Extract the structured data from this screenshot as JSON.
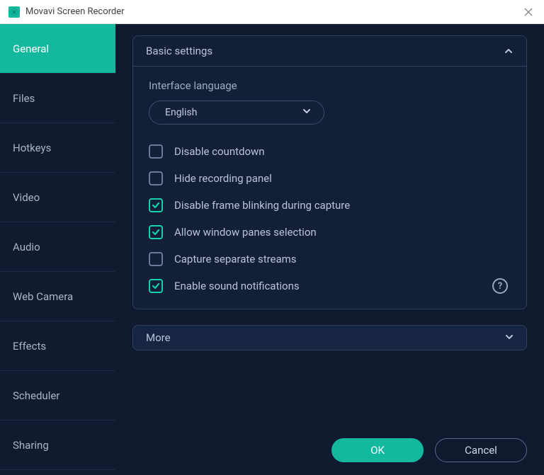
{
  "window": {
    "title": "Movavi Screen Recorder"
  },
  "sidebar": {
    "items": [
      {
        "label": "General",
        "active": true
      },
      {
        "label": "Files",
        "active": false
      },
      {
        "label": "Hotkeys",
        "active": false
      },
      {
        "label": "Video",
        "active": false
      },
      {
        "label": "Audio",
        "active": false
      },
      {
        "label": "Web Camera",
        "active": false
      },
      {
        "label": "Effects",
        "active": false
      },
      {
        "label": "Scheduler",
        "active": false
      },
      {
        "label": "Sharing",
        "active": false
      }
    ]
  },
  "panel": {
    "title": "Basic settings",
    "expanded": true,
    "language_label": "Interface language",
    "language_value": "English",
    "options": [
      {
        "label": "Disable countdown",
        "checked": false
      },
      {
        "label": "Hide recording panel",
        "checked": false
      },
      {
        "label": "Disable frame blinking during capture",
        "checked": true
      },
      {
        "label": "Allow window panes selection",
        "checked": true
      },
      {
        "label": "Capture separate streams",
        "checked": false
      },
      {
        "label": "Enable sound notifications",
        "checked": true
      }
    ]
  },
  "more": {
    "label": "More"
  },
  "footer": {
    "ok": "OK",
    "cancel": "Cancel"
  }
}
